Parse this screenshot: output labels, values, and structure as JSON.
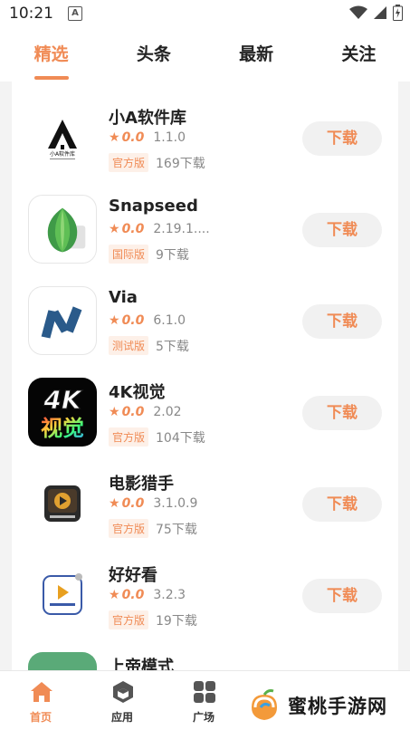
{
  "status_bar": {
    "time": "10:21",
    "notif_letter": "A"
  },
  "tabs": [
    {
      "label": "精选",
      "active": true
    },
    {
      "label": "头条",
      "active": false
    },
    {
      "label": "最新",
      "active": false
    },
    {
      "label": "关注",
      "active": false
    }
  ],
  "apps": [
    {
      "name": "小A软件库",
      "score": "0.0",
      "version": "1.1.0",
      "badge": "官方版",
      "downloads": "169下载",
      "icon": "xiaoa-logo-icon",
      "logo_text": "小A软件库"
    },
    {
      "name": "Snapseed",
      "score": "0.0",
      "version": "2.19.1....",
      "badge": "国际版",
      "downloads": "9下载",
      "icon": "snapseed-leaf-icon"
    },
    {
      "name": "Via",
      "score": "0.0",
      "version": "6.1.0",
      "badge": "测试版",
      "downloads": "5下载",
      "icon": "via-logo-icon"
    },
    {
      "name": "4K视觉",
      "score": "0.0",
      "version": "2.02",
      "badge": "官方版",
      "downloads": "104下载",
      "icon": "4k-visual-icon",
      "logo_text": "4K视觉"
    },
    {
      "name": "电影猎手",
      "score": "0.0",
      "version": "3.1.0.9",
      "badge": "官方版",
      "downloads": "75下载",
      "icon": "movie-hunter-icon"
    },
    {
      "name": "好好看",
      "score": "0.0",
      "version": "3.2.3",
      "badge": "官方版",
      "downloads": "19下载",
      "icon": "haohaokan-icon"
    },
    {
      "name": "上帝模式",
      "icon": "god-mode-icon"
    }
  ],
  "download_label": "下载",
  "bottom_nav": [
    {
      "label": "首页",
      "active": true,
      "icon": "home-icon"
    },
    {
      "label": "应用",
      "active": false,
      "icon": "cube-icon"
    },
    {
      "label": "广场",
      "active": false,
      "icon": "grid-icon"
    }
  ],
  "watermark": {
    "text": "蜜桃手游网"
  },
  "colors": {
    "accent": "#f08b55",
    "badge_bg": "#fdf0e8",
    "button_bg": "#f1f1f1",
    "page_bg": "#f3f3f3"
  }
}
